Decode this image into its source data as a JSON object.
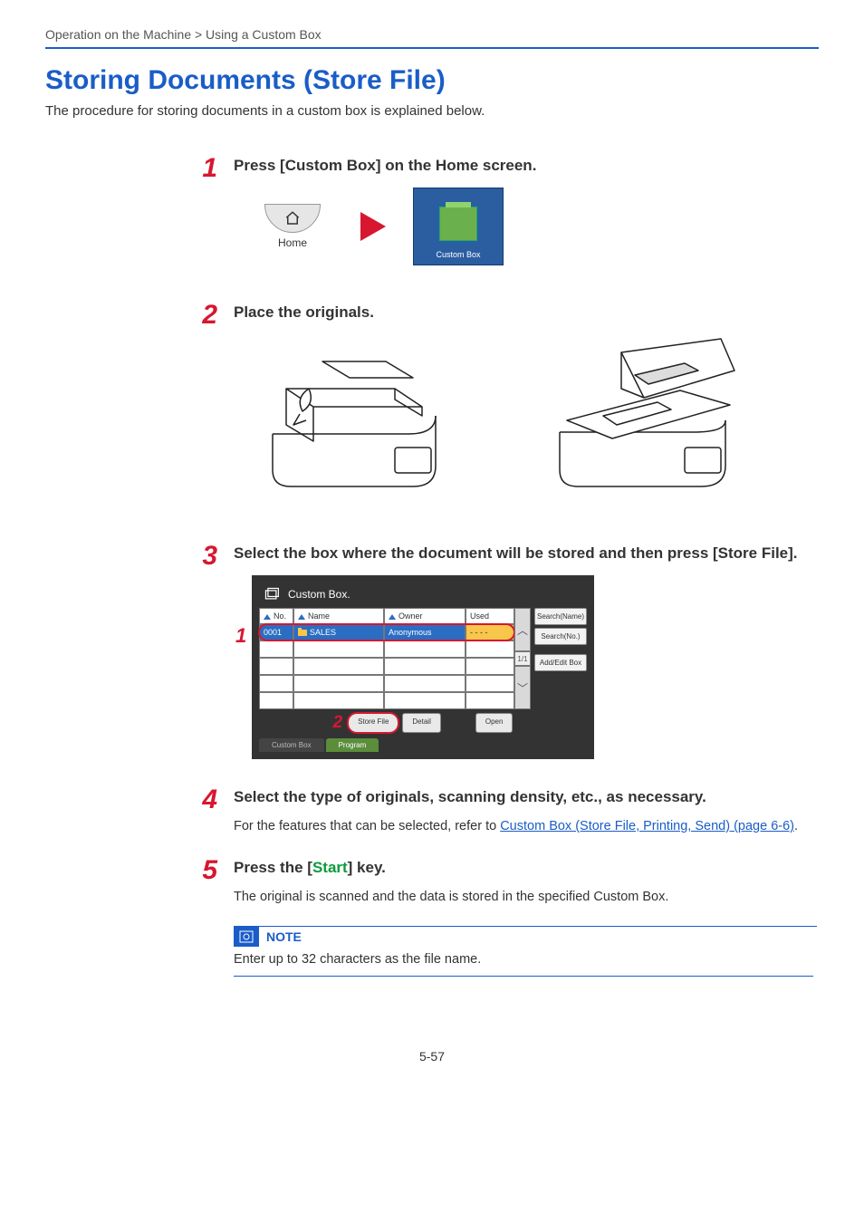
{
  "breadcrumb": "Operation on the Machine > Using a Custom Box",
  "title": "Storing Documents (Store File)",
  "intro": "The procedure for storing documents in a custom box is explained below.",
  "steps": {
    "s1": {
      "num": "1",
      "heading": "Press [Custom Box] on the Home screen.",
      "home_label": "Home",
      "tile_label": "Custom Box"
    },
    "s2": {
      "num": "2",
      "heading": "Place the originals."
    },
    "s3": {
      "num": "3",
      "heading": "Select the box where the document will be stored and then press [Store File]."
    },
    "s4": {
      "num": "4",
      "heading": "Select the type of originals, scanning density, etc., as necessary.",
      "text_prefix": "For the features that can be selected, refer to ",
      "link_text": "Custom Box (Store File, Printing, Send) (page 6-6)",
      "text_suffix": "."
    },
    "s5": {
      "num": "5",
      "heading_prefix": "Press the [",
      "heading_green": "Start",
      "heading_suffix": "] key.",
      "text": "The original is scanned and the data is stored in the specified Custom Box."
    }
  },
  "panel": {
    "title": "Custom Box.",
    "headers": {
      "no": "No.",
      "name": "Name",
      "owner": "Owner",
      "used": "Used"
    },
    "row": {
      "no": "0001",
      "name": "SALES",
      "owner": "Anonymous",
      "used": "- - - -"
    },
    "page_ind": "1/1",
    "side": {
      "search_name": "Search(Name)",
      "search_no": "Search(No.)",
      "add_edit": "Add/Edit Box"
    },
    "bottom": {
      "store_file": "Store File",
      "detail": "Detail",
      "open": "Open"
    },
    "tabs": {
      "custom_box": "Custom Box",
      "program": "Program"
    },
    "marker1": "1",
    "marker2": "2"
  },
  "note": {
    "label": "NOTE",
    "body": "Enter up to 32 characters as the file name."
  },
  "page_number": "5-57"
}
